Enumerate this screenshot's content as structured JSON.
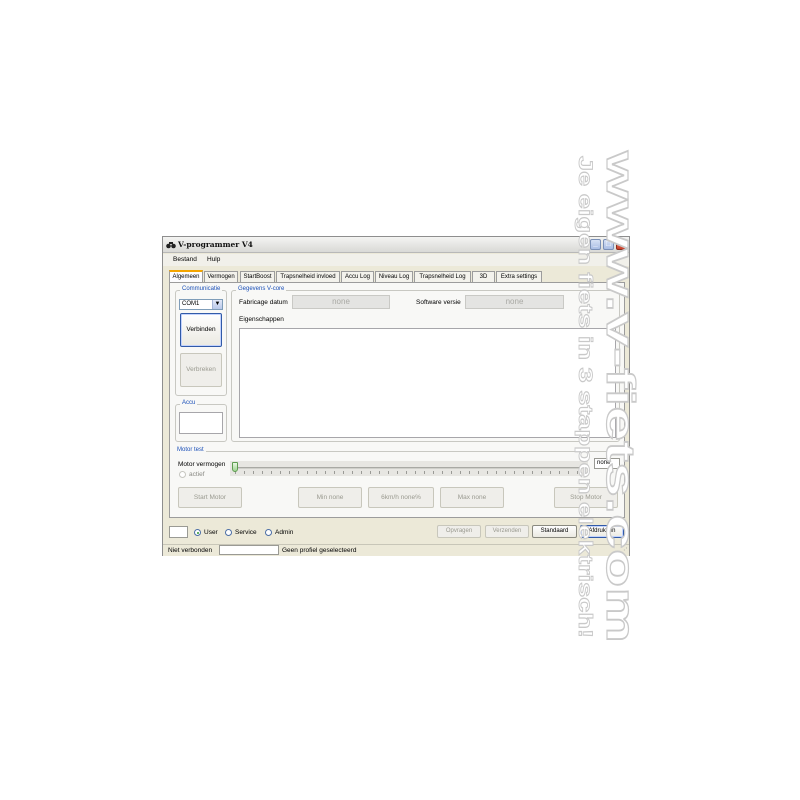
{
  "window": {
    "title": "V-programmer V4",
    "controls": {
      "minimize": "_",
      "maximize": "□",
      "close": "✕"
    }
  },
  "menu": [
    "Bestand",
    "Hulp"
  ],
  "tabs": [
    "Algemeen",
    "Vermogen",
    "StartBoost",
    "Trapsnelheid invloed",
    "Accu Log",
    "Niveau Log",
    "Trapsnelheid Log",
    "3D",
    "Extra settings"
  ],
  "communicatie": {
    "legend": "Communicatie",
    "port": "COM1",
    "connect_label": "Verbinden",
    "disconnect_label": "Verbreken"
  },
  "accu": {
    "legend": "Accu"
  },
  "vcore": {
    "legend": "Gegevens V-core",
    "fabricage_label": "Fabricage datum",
    "fabricage_value": "none",
    "software_label": "Software versie",
    "software_value": "none",
    "properties_label": "Eigenschappen"
  },
  "motor_test": {
    "legend": "Motor test",
    "power_label": "Motor vermogen",
    "active_label": "actief",
    "slider_value": "none",
    "slider_level": 0,
    "start_label": "Start Motor",
    "min_label": "Min none",
    "speed_label": "6km/h none%",
    "max_label": "Max none",
    "stop_label": "Stop Motor"
  },
  "bottom": {
    "roles": [
      "User",
      "Service",
      "Admin"
    ],
    "selected_role": "User",
    "opvragen_label": "Opvragen",
    "verzenden_label": "Verzenden",
    "standaard_label": "Standaard",
    "afdrukken_label": "Afdrukken"
  },
  "status": {
    "connection": "Niet verbonden",
    "profile": "Geen profiel geselecteerd"
  },
  "watermark": {
    "line1": "www.v-fiets.com",
    "line2": "Je eigen fiets in 3 stappen elektrisch!"
  }
}
